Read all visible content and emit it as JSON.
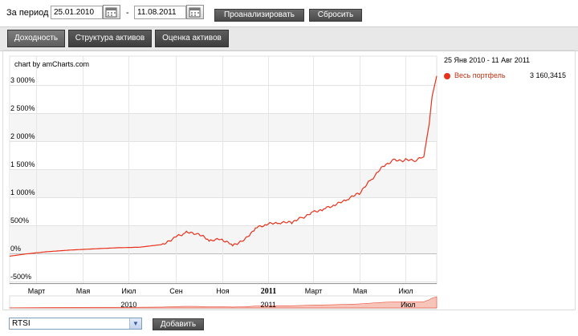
{
  "filter": {
    "period_label": "За период",
    "date_from": "25.01.2010",
    "dash": "-",
    "date_to": "11.08.2011",
    "analyze_label": "Проанализировать",
    "reset_label": "Сбросить"
  },
  "tabs": [
    {
      "label": "Доходность",
      "active": true
    },
    {
      "label": "Структура активов",
      "active": false
    },
    {
      "label": "Оценка активов",
      "active": false
    }
  ],
  "chart_credit": "chart by amCharts.com",
  "legend": {
    "range": "25 Янв 2010 - 11 Авг 2011",
    "series_name": "Весь портфель",
    "series_value": "3 160,3415",
    "series_color": "#e8311a"
  },
  "chart_data": {
    "type": "line",
    "ytick_labels": [
      "3 000%",
      "2 500%",
      "2 000%",
      "1 500%",
      "1 000%",
      "500%",
      "0%",
      "-500%"
    ],
    "ylim": [
      -500,
      3100
    ],
    "xtick_labels": [
      "Март",
      "Мая",
      "Июл",
      "Сен",
      "Ноя",
      "2011",
      "Март",
      "Мая",
      "Июл"
    ],
    "scroll_labels": [
      "2010",
      "2011",
      "Июл"
    ],
    "series": [
      {
        "name": "Весь портфель",
        "color": "#e8311a",
        "x": [
          "2010-01-25",
          "2010-02-15",
          "2010-03-15",
          "2010-04-15",
          "2010-05-15",
          "2010-06-15",
          "2010-07-15",
          "2010-08-15",
          "2010-09-01",
          "2010-09-15",
          "2010-10-01",
          "2010-10-15",
          "2010-11-01",
          "2010-11-15",
          "2010-12-01",
          "2010-12-15",
          "2011-01-01",
          "2011-01-15",
          "2011-02-01",
          "2011-02-15",
          "2011-03-01",
          "2011-03-15",
          "2011-04-01",
          "2011-04-15",
          "2011-05-01",
          "2011-05-15",
          "2011-06-01",
          "2011-06-15",
          "2011-07-01",
          "2011-07-15",
          "2011-07-25",
          "2011-08-01",
          "2011-08-05",
          "2011-08-11"
        ],
        "values": [
          -50,
          -10,
          30,
          60,
          80,
          100,
          110,
          160,
          300,
          370,
          340,
          230,
          250,
          150,
          250,
          450,
          520,
          540,
          550,
          640,
          740,
          790,
          870,
          960,
          1070,
          1290,
          1560,
          1660,
          1660,
          1660,
          1720,
          2300,
          2800,
          3160
        ]
      }
    ],
    "grid": true,
    "legend_position": "right"
  },
  "compare": {
    "selected": "RTSI",
    "add_label": "Добавить"
  },
  "icons": {
    "calendar": "calendar-icon",
    "dropdown": "chevron-down-icon"
  }
}
